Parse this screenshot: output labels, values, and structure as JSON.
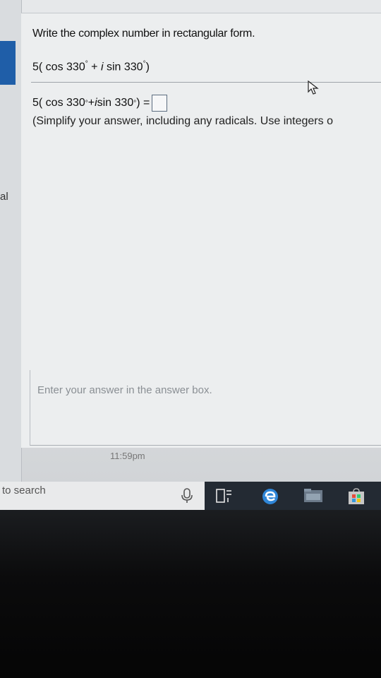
{
  "question": {
    "title": "Write the complex number in rectangular form.",
    "expression": {
      "prefix": "5( cos 330",
      "degree": "°",
      "plus": " + ",
      "i": "i",
      "sin_part": " sin 330",
      "close": ")"
    },
    "answer_row": {
      "prefix": "5( cos 330",
      "degree": "°",
      "plus": " + ",
      "i": "i",
      "sin_part": " sin 330",
      "close_eq": ") ="
    },
    "instructions": "(Simplify your answer, including any radicals. Use integers o"
  },
  "status": {
    "hint": "Enter your answer in the answer box.",
    "time": "11:59pm"
  },
  "left_panel": {
    "label": "al"
  },
  "taskbar": {
    "search_placeholder": "to search"
  },
  "colors": {
    "accent": "#1f5ea8",
    "taskbar": "#232a33"
  }
}
